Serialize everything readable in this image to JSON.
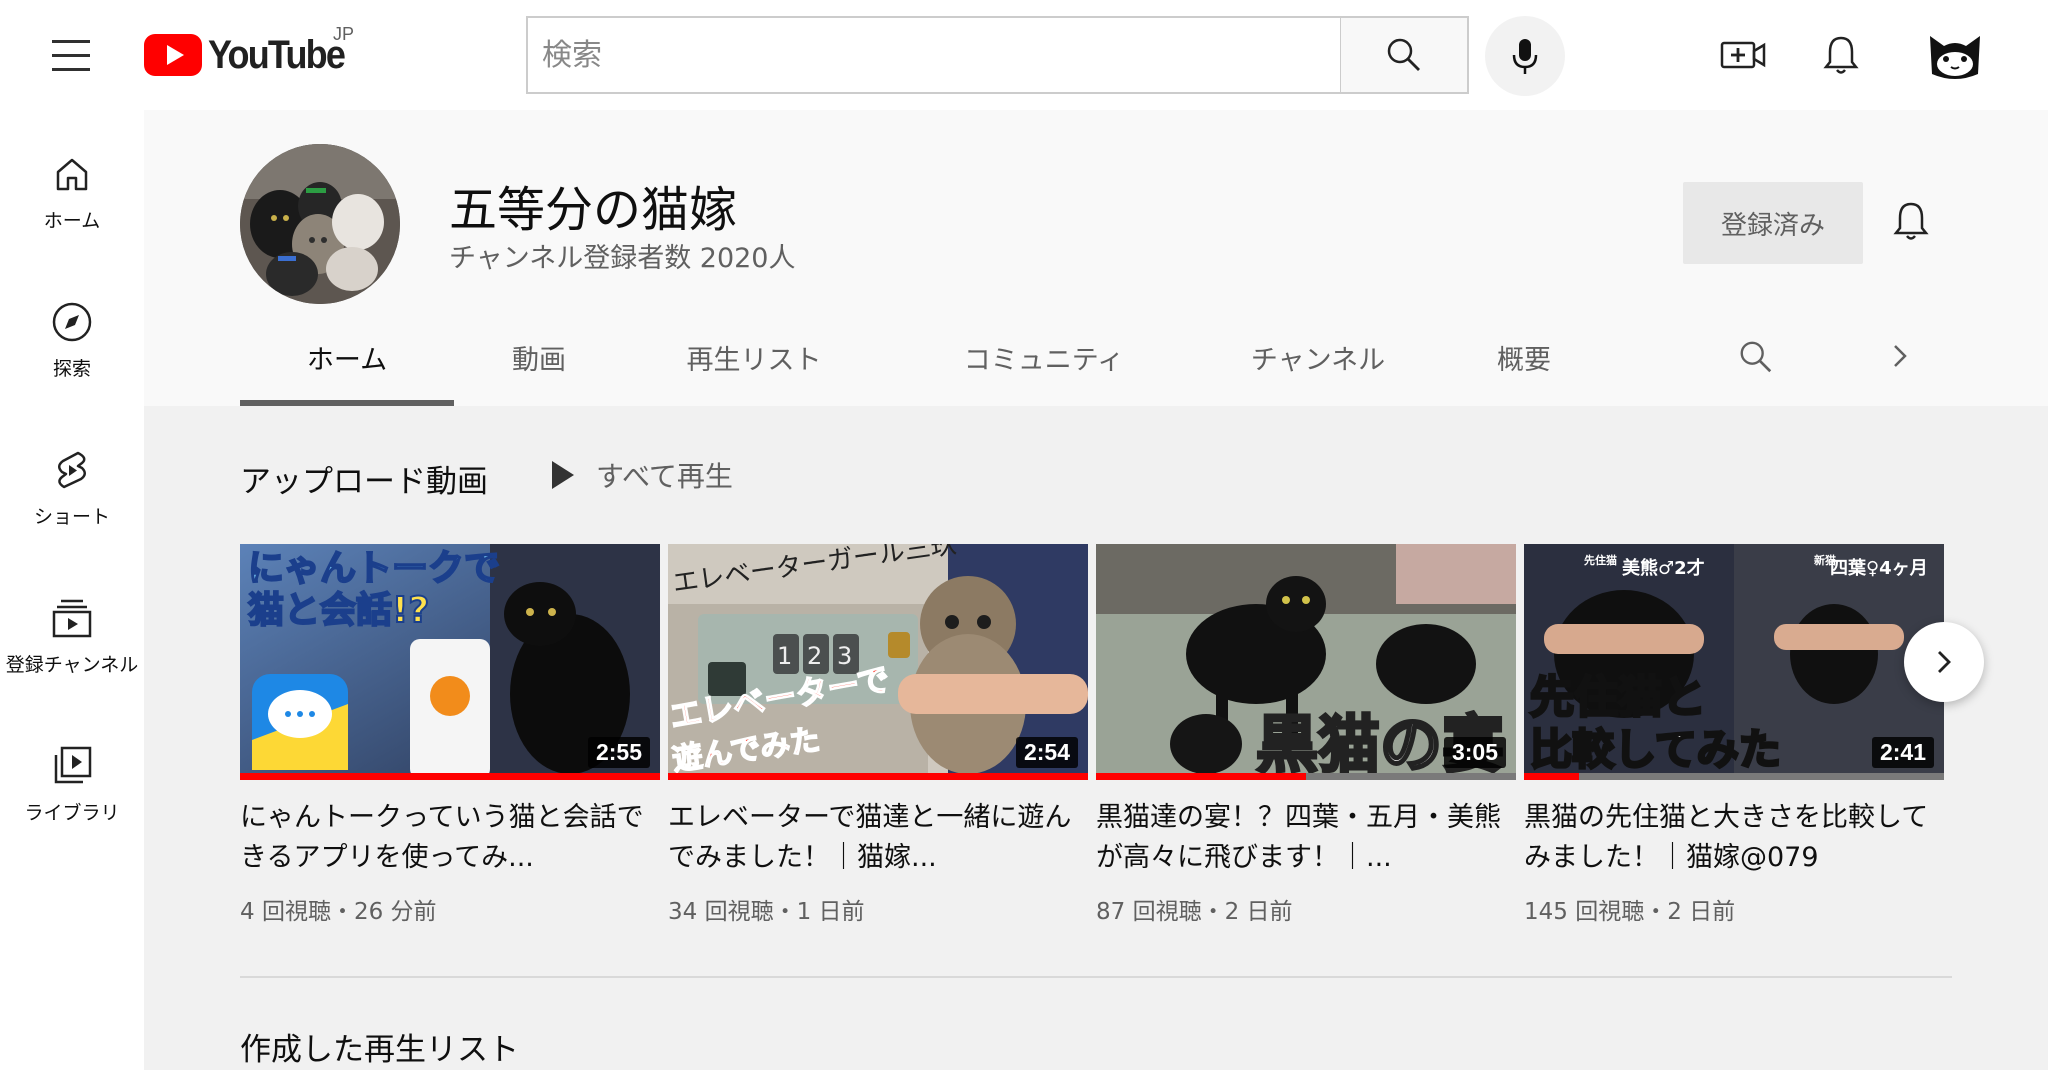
{
  "header": {
    "logo_text": "YouTube",
    "region": "JP",
    "search_placeholder": "検索"
  },
  "sidebar": {
    "items": [
      {
        "label": "ホーム"
      },
      {
        "label": "探索"
      },
      {
        "label": "ショート"
      },
      {
        "label": "登録チャンネル"
      },
      {
        "label": "ライブラリ"
      }
    ]
  },
  "channel": {
    "name": "五等分の猫嫁",
    "subscribers": "チャンネル登録者数 2020人",
    "subscribe_label": "登録済み",
    "tabs": [
      "ホーム",
      "動画",
      "再生リスト",
      "コミュニティ",
      "チャンネル",
      "概要"
    ],
    "active_tab": "ホーム"
  },
  "uploads": {
    "title": "アップロード動画",
    "play_all": "すべて再生",
    "videos": [
      {
        "title": "にゃんトークっていう猫と会話できるアプリを使ってみ...",
        "meta": "4 回視聴・26 分前",
        "duration": "2:55",
        "progress": 1.0,
        "overlay_lines": [
          "にゃんトークで",
          "猫と会話!?"
        ]
      },
      {
        "title": "エレベーターで猫達と一緒に遊んでみました！｜猫嫁...",
        "meta": "34 回視聴・1 日前",
        "duration": "2:54",
        "progress": 1.0,
        "overlay_top": "エレベーターガール三玖",
        "overlay_lines": [
          "エレベーターで",
          "遊んでみた"
        ],
        "panel_buttons": [
          "1",
          "2",
          "3"
        ]
      },
      {
        "title": "黒猫達の宴！？四葉・五月・美熊が高々に飛びます！｜...",
        "meta": "87 回視聴・2 日前",
        "duration": "3:05",
        "progress": 0.5,
        "overlay_lines": [
          "黒猫の宴"
        ]
      },
      {
        "title": "黒猫の先住猫と大きさを比較してみました！｜猫嫁@079",
        "meta": "145 回視聴・2 日前",
        "duration": "2:41",
        "progress": 0.13,
        "label_left_small": "先住猫",
        "label_left": "美熊♂2才",
        "label_right_small": "新猫",
        "label_right": "四葉♀4ヶ月",
        "overlay_lines": [
          "先住猫と",
          "比較してみた"
        ]
      }
    ]
  },
  "playlists": {
    "title": "作成した再生リスト"
  }
}
